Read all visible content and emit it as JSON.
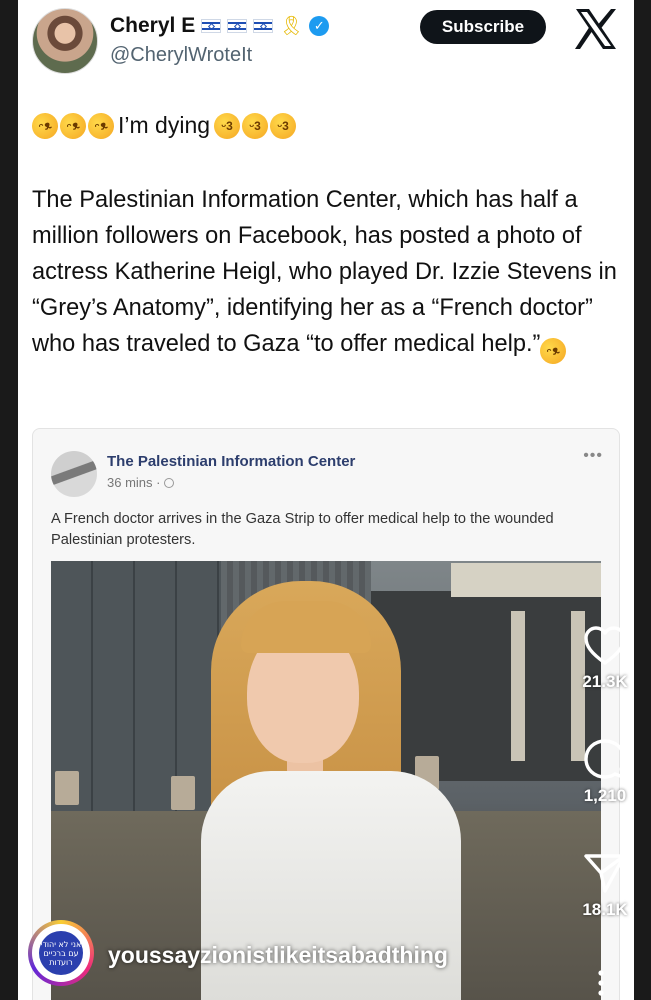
{
  "tweet": {
    "display_name": "Cheryl E",
    "handle": "@CherylWroteIt",
    "subscribe_label": "Subscribe",
    "lead_text": "I’m dying",
    "body": "The Palestinian Information Center, which has half a million followers on Facebook, has posted a photo of actress Katherine Heigl, who played Dr. Izzie Stevens in “Grey’s Anatomy”, identifying her as a “French doctor” who has traveled to Gaza “to offer medical help.”"
  },
  "embed": {
    "page_name": "The Palestinian Information Center",
    "time": "36 mins ·",
    "caption": "A French doctor arrives in the Gaza Strip to offer medical help to the wounded Palestinian protesters."
  },
  "reel": {
    "likes": "21.3K",
    "comments": "1,210",
    "shares": "18.1K",
    "username": "youssayzionistlikeitsabadthing",
    "avatar_text": "אני לא יהודי עם ברכיים רועדות"
  },
  "colors": {
    "verified": "#1d9bf0",
    "subscribe_bg": "#0f1419",
    "fb_name": "#2d3e6d"
  },
  "icons": {
    "verified": "verified-check-icon",
    "ribbon": "yellow-ribbon-icon",
    "x_logo": "x-logo-icon",
    "like": "heart-icon",
    "comment": "comment-bubble-icon",
    "share": "paper-plane-icon",
    "more": "more-vertical-icon"
  }
}
